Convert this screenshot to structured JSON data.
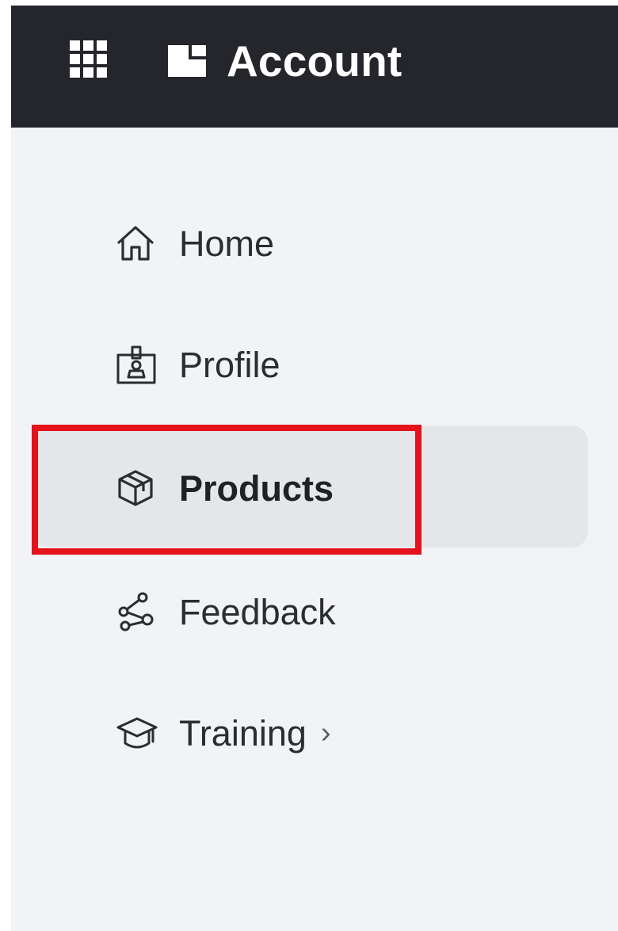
{
  "header": {
    "title": "Account",
    "apps_icon": "grid-apps-icon",
    "logo_icon": "brand-logo-icon",
    "background": "#24262b"
  },
  "sidebar": {
    "background": "#f2f3f7",
    "active_background": "#e4e6ea",
    "highlight_color": "#e3121b",
    "items": [
      {
        "label": "Home",
        "icon": "home-icon",
        "active": false
      },
      {
        "label": "Profile",
        "icon": "profile-badge-icon",
        "active": false
      },
      {
        "label": "Products",
        "icon": "box-icon",
        "active": true
      },
      {
        "label": "Feedback",
        "icon": "feedback-nodes-icon",
        "active": false
      },
      {
        "label": "Training",
        "icon": "graduation-cap-icon",
        "active": false,
        "has_submenu": true,
        "chevron": "›"
      }
    ]
  }
}
